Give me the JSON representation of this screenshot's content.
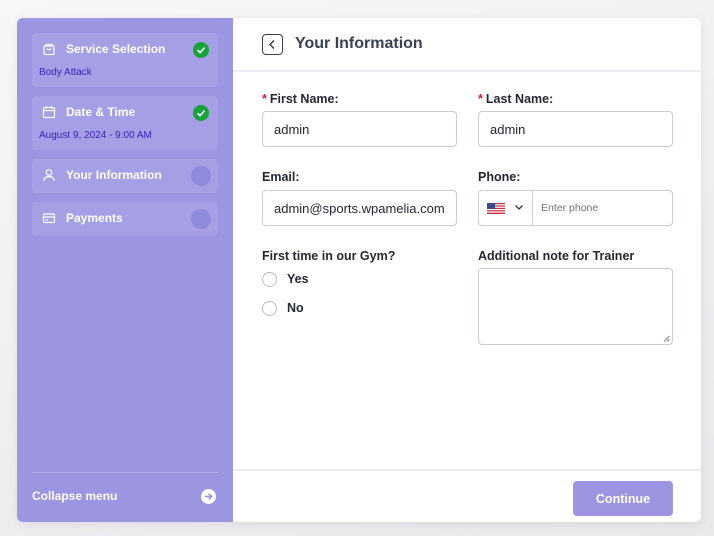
{
  "sidebar": {
    "steps": [
      {
        "label": "Service Selection",
        "sub": "Body Attack",
        "status": "completed"
      },
      {
        "label": "Date & Time",
        "sub": "August 9, 2024 - 9:00 AM",
        "status": "completed"
      },
      {
        "label": "Your Information",
        "sub": "",
        "status": "current"
      },
      {
        "label": "Payments",
        "sub": "",
        "status": "pending"
      }
    ],
    "collapse_label": "Collapse menu"
  },
  "header": {
    "title": "Your Information"
  },
  "form": {
    "first_name": {
      "label": "First Name:",
      "value": "admin",
      "required": true
    },
    "last_name": {
      "label": "Last Name:",
      "value": "admin",
      "required": true
    },
    "email": {
      "label": "Email:",
      "value": "admin@sports.wpamelia.com"
    },
    "phone": {
      "label": "Phone:",
      "placeholder": "Enter phone",
      "country_flag": "us-flag-icon"
    },
    "first_time": {
      "label": "First time in our Gym?",
      "options": [
        "Yes",
        "No"
      ]
    },
    "note": {
      "label": "Additional note for Trainer",
      "value": ""
    },
    "required_mark": "*"
  },
  "footer": {
    "continue_label": "Continue"
  },
  "colors": {
    "accent": "#9b95e2",
    "check": "#18a23b",
    "required": "#d3242b",
    "sub_text": "#3d23b9"
  }
}
